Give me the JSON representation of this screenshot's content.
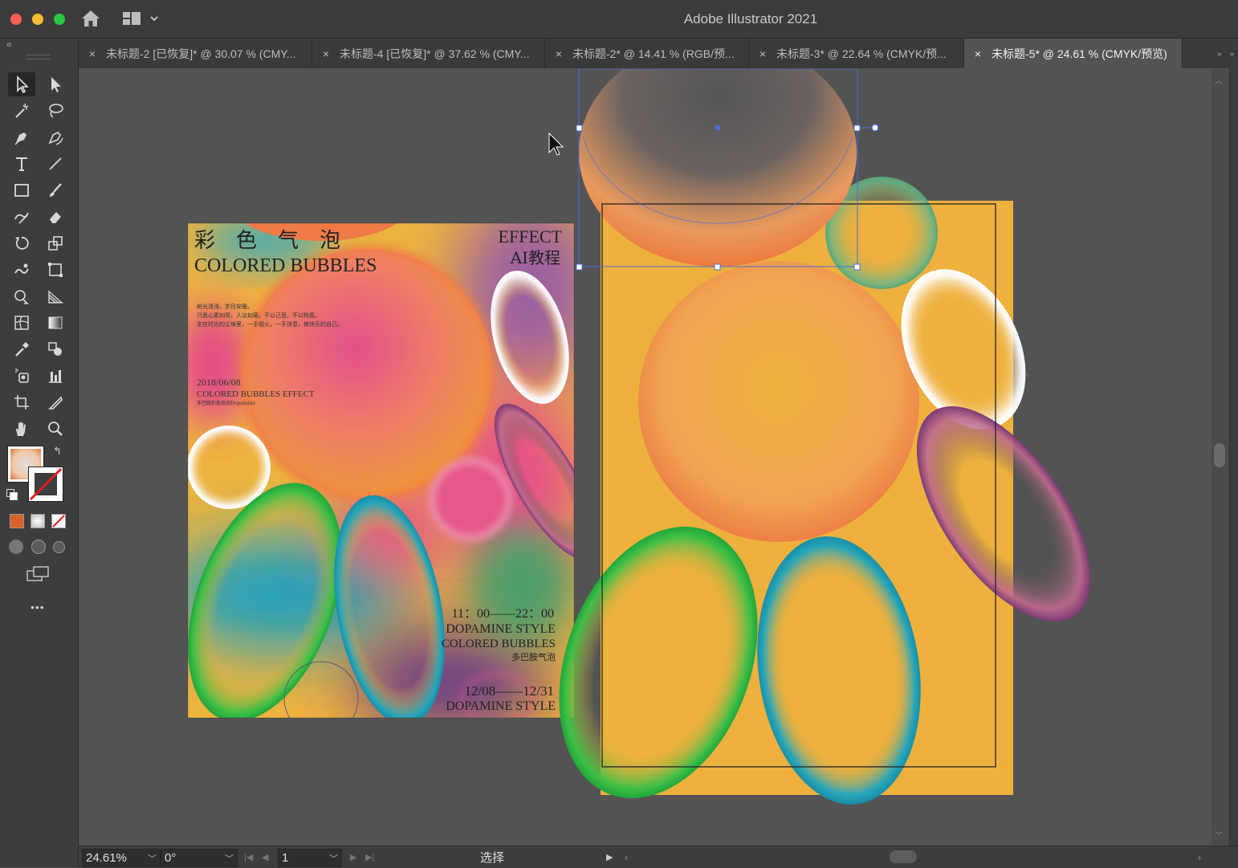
{
  "window": {
    "title": "Adobe Illustrator 2021"
  },
  "tabs": [
    {
      "label": "未标题-2 [已恢复]* @ 30.07 % (CMY...",
      "active": false
    },
    {
      "label": "未标题-4 [已恢复]* @ 37.62 % (CMY...",
      "active": false
    },
    {
      "label": "未标题-2* @ 14.41 % (RGB/预...",
      "active": false
    },
    {
      "label": "未标题-3* @ 22.64 % (CMYK/预...",
      "active": false
    },
    {
      "label": "未标题-5* @ 24.61 % (CMYK/预览)",
      "active": true
    }
  ],
  "tab_close_glyph": "×",
  "toolbar": {
    "tools": [
      "selection-tool",
      "direct-selection-tool",
      "magic-wand-tool",
      "lasso-tool",
      "pen-tool",
      "curvature-tool",
      "type-tool",
      "line-segment-tool",
      "rectangle-tool",
      "paintbrush-tool",
      "shaper-tool",
      "eraser-tool",
      "rotate-tool",
      "scale-tool",
      "warp-tool",
      "free-transform-tool",
      "shape-builder-tool",
      "perspective-grid-tool",
      "mesh-tool",
      "gradient-tool",
      "eyedropper-tool",
      "blend-tool",
      "symbol-sprayer-tool",
      "column-graph-tool",
      "artboard-tool",
      "slice-tool",
      "hand-tool",
      "zoom-tool"
    ],
    "more_label": "•••"
  },
  "poster": {
    "title_cn": "彩　色　气　泡",
    "title_en": "COLORED BUBBLES",
    "effect": "EFFECT",
    "ai_tutorial": "AI教程",
    "body_lines": [
      "树光清浅，岁月安暖。",
      "只愿心素如简，人淡如菊。不以己悲，不以物喜。",
      "坐在时光的尘埃里，一手烟火，一手诗意，做快乐的自己。"
    ],
    "date": "2018/06/08",
    "subtitle": "COLORED BUBBLES EFFECT",
    "small_line": "多巴胺彩色泡泡Dopamine",
    "time": "11：00——22：00",
    "style1": "DOPAMINE STYLE",
    "style_bubbles": "COLORED BUBBLES",
    "cn_small": "多巴胺气泡",
    "date_range": "12/08——12/31",
    "style2": "DOPAMINE STYLE"
  },
  "colors": {
    "poster_bg": "#EDB33F",
    "artboard_bg": "#EEB13E",
    "selection": "#4A6FD8",
    "ui_dark": "#3D3D3D",
    "canvas": "#535353"
  },
  "status": {
    "zoom": "24.61%",
    "rotation": "0°",
    "artboard_num": "1",
    "tool_name": "选择"
  }
}
